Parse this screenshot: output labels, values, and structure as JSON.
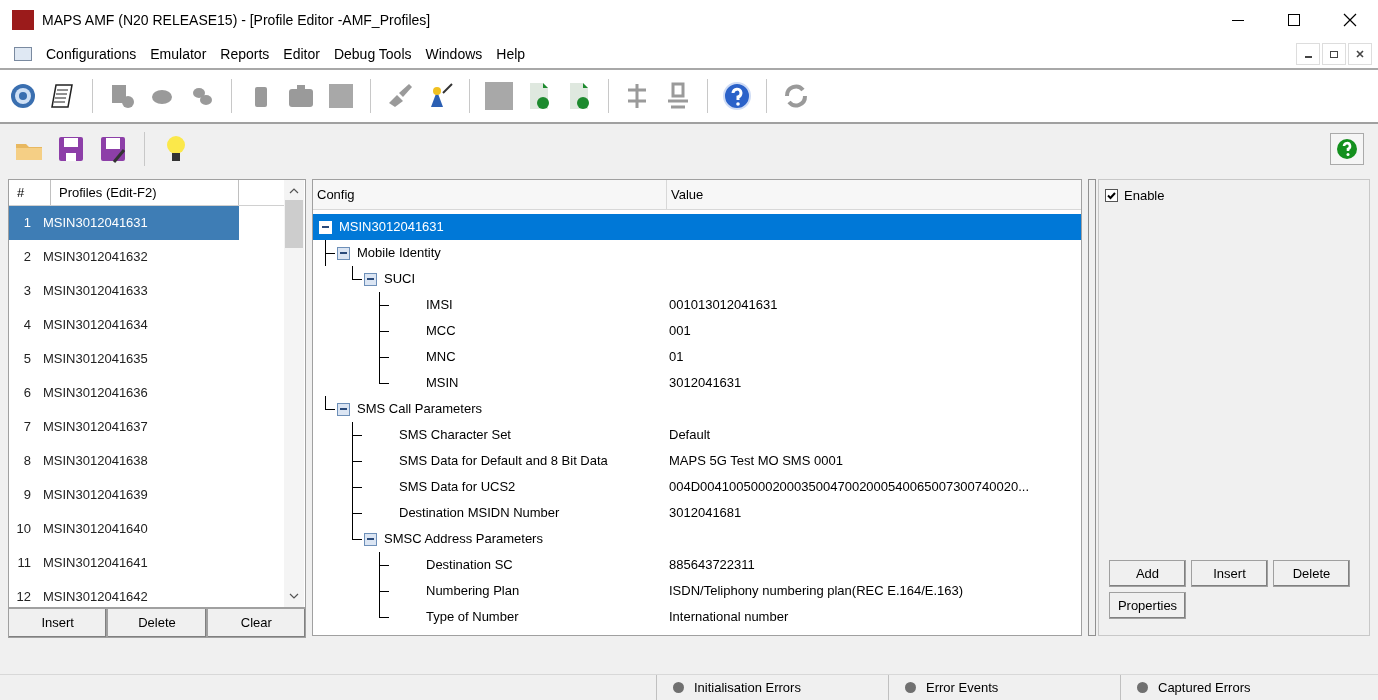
{
  "window": {
    "title": "MAPS AMF (N20 RELEASE15) - [Profile Editor -AMF_Profiles]"
  },
  "menu": [
    "Configurations",
    "Emulator",
    "Reports",
    "Editor",
    "Debug Tools",
    "Windows",
    "Help"
  ],
  "profiles": {
    "columns": [
      "#",
      "Profiles (Edit-F2)"
    ],
    "rows": [
      {
        "num": "1",
        "name": "MSIN3012041631",
        "selected": true
      },
      {
        "num": "2",
        "name": "MSIN3012041632",
        "selected": false
      },
      {
        "num": "3",
        "name": "MSIN3012041633",
        "selected": false
      },
      {
        "num": "4",
        "name": "MSIN3012041634",
        "selected": false
      },
      {
        "num": "5",
        "name": "MSIN3012041635",
        "selected": false
      },
      {
        "num": "6",
        "name": "MSIN3012041636",
        "selected": false
      },
      {
        "num": "7",
        "name": "MSIN3012041637",
        "selected": false
      },
      {
        "num": "8",
        "name": "MSIN3012041638",
        "selected": false
      },
      {
        "num": "9",
        "name": "MSIN3012041639",
        "selected": false
      },
      {
        "num": "10",
        "name": "MSIN3012041640",
        "selected": false
      },
      {
        "num": "11",
        "name": "MSIN3012041641",
        "selected": false
      },
      {
        "num": "12",
        "name": "MSIN3012041642",
        "selected": false
      }
    ],
    "buttons": [
      "Insert",
      "Delete",
      "Clear"
    ]
  },
  "config": {
    "columns": [
      "Config",
      "Value"
    ],
    "tree": [
      {
        "label": "MSIN3012041631",
        "expanded": true,
        "selected": true,
        "children": [
          {
            "label": "Mobile Identity",
            "expanded": true,
            "selected": false,
            "children": [
              {
                "label": "SUCI",
                "expanded": true,
                "selected": false,
                "children": [
                  {
                    "label": "IMSI",
                    "value": "001013012041631",
                    "selected": false
                  },
                  {
                    "label": "MCC",
                    "value": "001",
                    "selected": false
                  },
                  {
                    "label": "MNC",
                    "value": "01",
                    "selected": false
                  },
                  {
                    "label": "MSIN",
                    "value": "3012041631",
                    "selected": false
                  }
                ]
              }
            ]
          },
          {
            "label": "SMS Call Parameters",
            "expanded": true,
            "selected": false,
            "children": [
              {
                "label": "SMS Character Set",
                "value": "Default",
                "selected": false
              },
              {
                "label": "SMS Data for Default and 8 Bit Data",
                "value": "MAPS 5G Test MO SMS 0001",
                "selected": false
              },
              {
                "label": "SMS Data for UCS2",
                "value": "004D00410050002000350047002000540065007300740020...",
                "selected": false
              },
              {
                "label": "Destination MSIDN Number",
                "value": "3012041681",
                "selected": false
              },
              {
                "label": "SMSC Address Parameters",
                "expanded": true,
                "selected": false,
                "children": [
                  {
                    "label": "Destination SC",
                    "value": "885643722311",
                    "selected": false
                  },
                  {
                    "label": "Numbering Plan",
                    "value": "ISDN/Teliphony numbering plan(REC E.164/E.163)",
                    "selected": false
                  },
                  {
                    "label": "Type of Number",
                    "value": "International number",
                    "selected": false
                  }
                ]
              }
            ]
          }
        ]
      }
    ]
  },
  "side": {
    "enable": {
      "label": "Enable",
      "checked": true
    },
    "buttons": [
      "Add",
      "Insert",
      "Delete"
    ],
    "properties_button": "Properties"
  },
  "status_bar": [
    "Initialisation Errors",
    "Error Events",
    "Captured Errors"
  ]
}
